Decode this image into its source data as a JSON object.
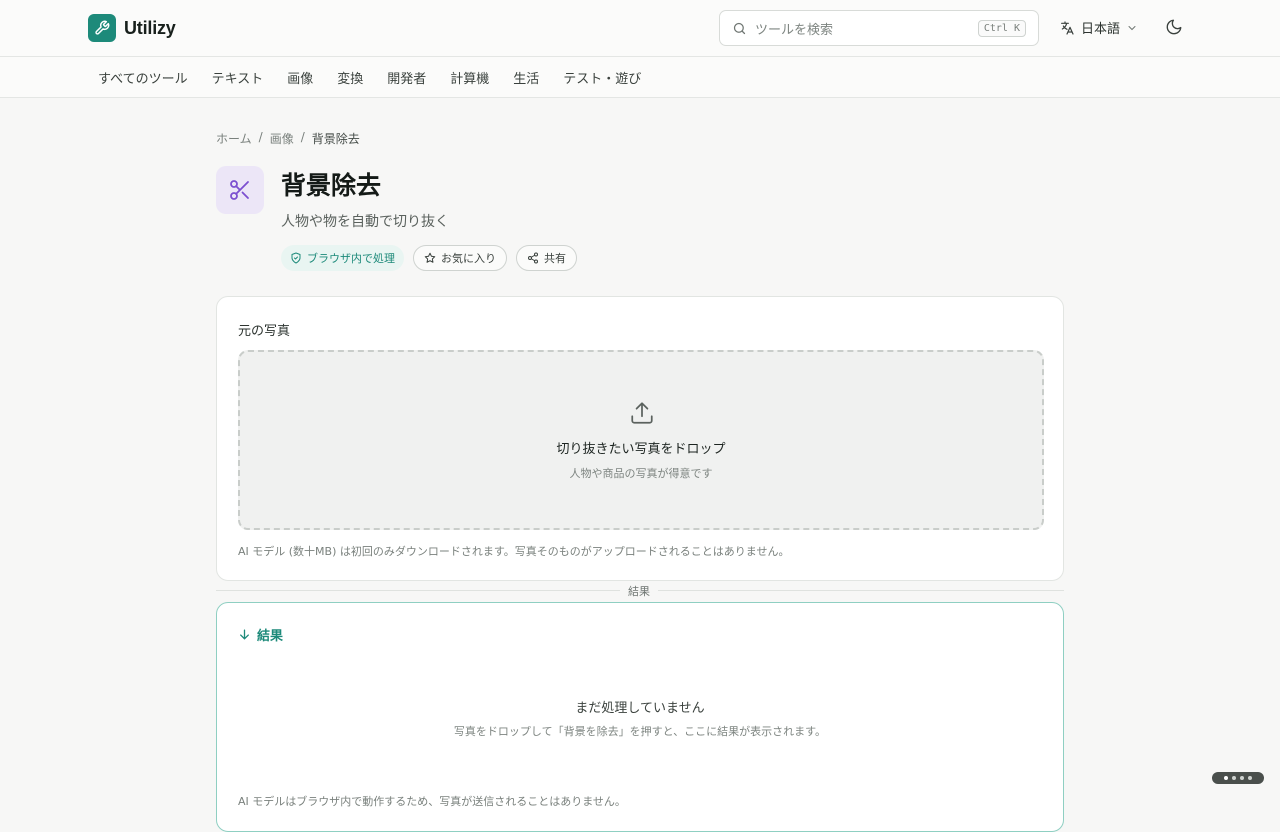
{
  "brand": {
    "name": "Utilizy",
    "accent": "#1d8a7a"
  },
  "search": {
    "placeholder": "ツールを検索",
    "shortcut": "Ctrl K"
  },
  "language": {
    "label": "日本語"
  },
  "categories": [
    "すべてのツール",
    "テキスト",
    "画像",
    "変換",
    "開発者",
    "計算機",
    "生活",
    "テスト・遊び"
  ],
  "breadcrumb": {
    "home": "ホーム",
    "section": "画像",
    "current": "背景除去",
    "separator": "/"
  },
  "tool": {
    "icon": "scissors-icon",
    "icon_bg": "#ece6f7",
    "icon_color": "#7c4fd0",
    "title": "背景除去",
    "subtitle": "人物や物を自動で切り抜く",
    "badge": "ブラウザ内で処理",
    "favorite_label": "お気に入り",
    "share_label": "共有"
  },
  "source": {
    "label": "元の写真",
    "drop_title": "切り抜きたい写真をドロップ",
    "drop_hint": "人物や商品の写真が得意です",
    "note": "AI モデル (数十MB) は初回のみダウンロードされます。写真そのものがアップロードされることはありません。"
  },
  "divider_label": "結果",
  "result": {
    "heading": "結果",
    "empty_title": "まだ処理していません",
    "empty_hint": "写真をドロップして「背景を除去」を押すと、ここに結果が表示されます。",
    "note": "AI モデルはブラウザ内で動作するため、写真が送信されることはありません。"
  },
  "pager": {
    "count": 4,
    "active": 0
  }
}
